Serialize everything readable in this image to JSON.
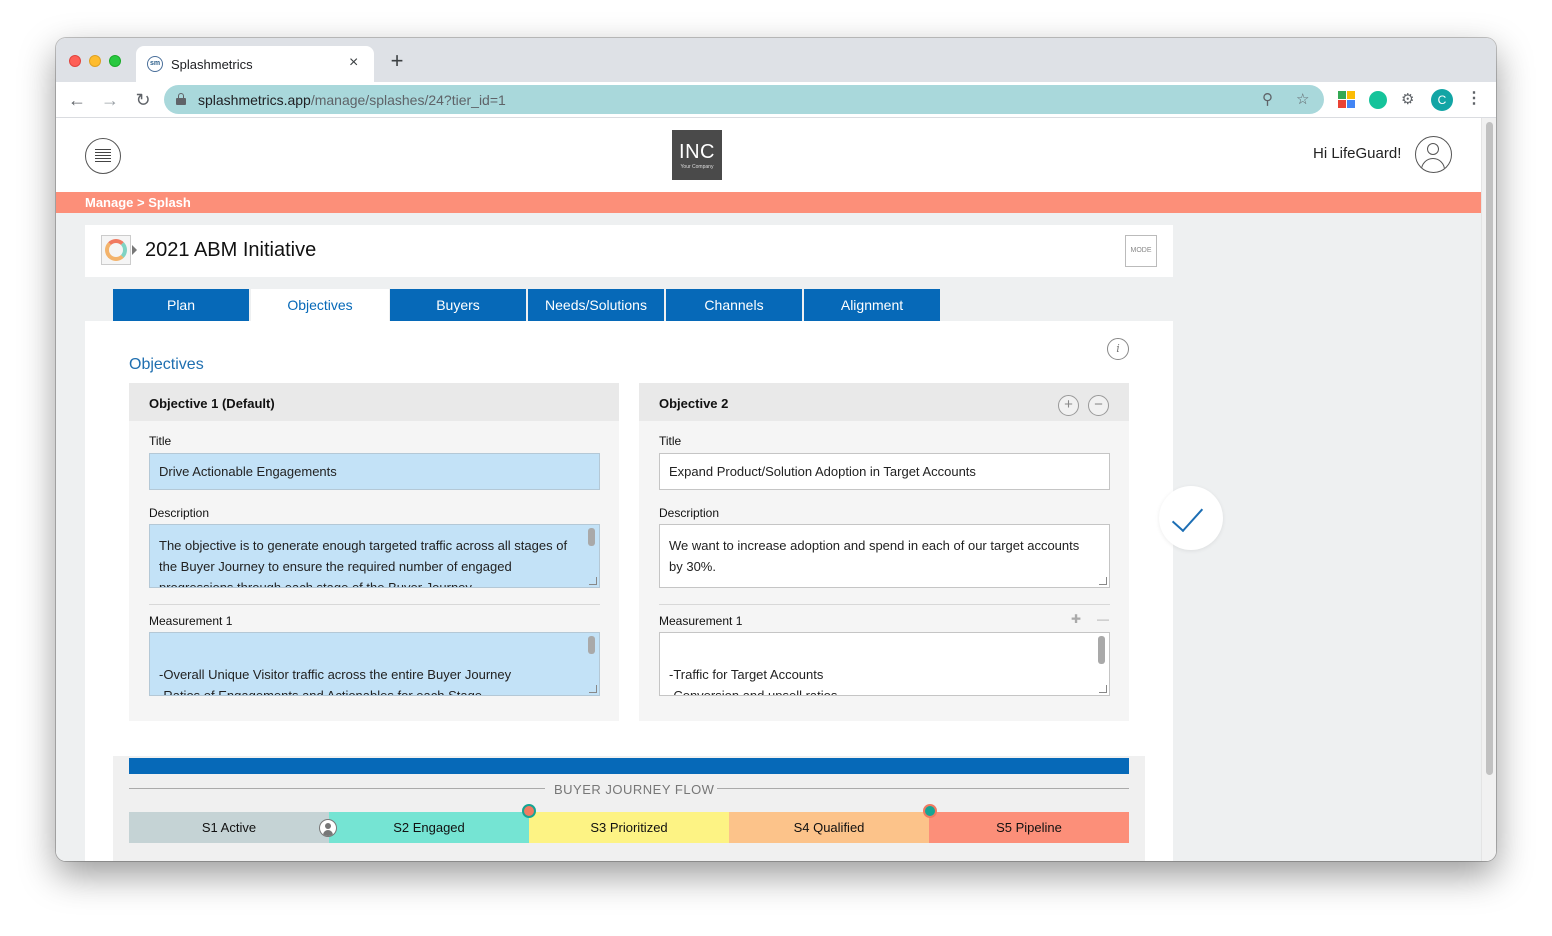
{
  "browser": {
    "tab_title": "Splashmetrics",
    "tab_close": "×",
    "new_tab": "+",
    "favicon_text": "sm",
    "url_host": "splashmetrics.app",
    "url_path": "/manage/splashes/24?tier_id=1",
    "profile_initial": "C"
  },
  "header": {
    "logo_text": "INC",
    "logo_subtext": "Your Company",
    "greeting": "Hi LifeGuard!"
  },
  "breadcrumb": "Manage > Splash",
  "splash": {
    "title": "2021 ABM Initiative",
    "mode_label": "MODE"
  },
  "tabs": [
    {
      "label": "Plan"
    },
    {
      "label": "Objectives"
    },
    {
      "label": "Buyers"
    },
    {
      "label": "Needs/Solutions"
    },
    {
      "label": "Channels"
    },
    {
      "label": "Alignment"
    }
  ],
  "active_tab": "Objectives",
  "section_title": "Objectives",
  "info_icon_glyph": "i",
  "objectives": [
    {
      "name": "Objective 1 (Default)",
      "title_label": "Title",
      "title_value": "Drive Actionable Engagements",
      "description_label": "Description",
      "description_value": "The objective is to generate enough targeted traffic across all stages of the Buyer Journey to ensure the required number of engaged progressions through each stage of the Buyer Journey.",
      "measurement_label": "Measurement 1",
      "measurement_value": "-Overall Unique Visitor traffic across the entire Buyer Journey\n-Ratios of Engagements and Actionables for each Stage\n-Referral Ratios for each inbound Channel and the correlation to the"
    },
    {
      "name": "Objective 2",
      "title_label": "Title",
      "title_value": "Expand Product/Solution Adoption in Target Accounts",
      "description_label": "Description",
      "description_value": "We want to increase adoption and spend in each of our target accounts by 30%.",
      "measurement_label": "Measurement 1",
      "measurement_value": "-Traffic for Target Accounts\n-Conversion and upsell ratios\n-Account Actionables"
    }
  ],
  "buttons": {
    "add_glyph": "+",
    "remove_glyph": "−",
    "mini_add_glyph": "✚",
    "mini_remove_glyph": "—"
  },
  "journey": {
    "label": "BUYER JOURNEY FLOW",
    "stages": [
      {
        "label": "S1 Active",
        "color": "#c5d3d5"
      },
      {
        "label": "S2 Engaged",
        "color": "#75e4d3"
      },
      {
        "label": "S3 Prioritized",
        "color": "#fdf384"
      },
      {
        "label": "S4 Qualified",
        "color": "#fcc38a"
      },
      {
        "label": "S5 Pipeline",
        "color": "#fc8f79"
      }
    ]
  },
  "colors": {
    "brand_blue": "#0669b8",
    "breadcrumb_bar": "#fc8f79",
    "highlight_input": "#c3e2f7",
    "omnibox": "#a9d8db"
  }
}
